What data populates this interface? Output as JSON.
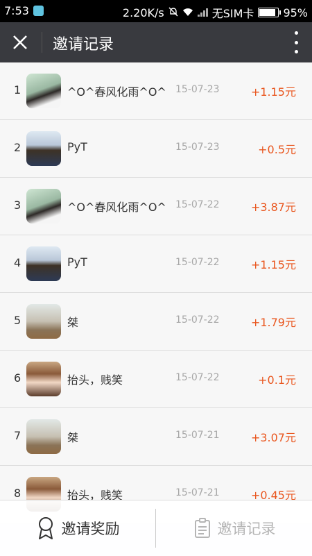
{
  "status": {
    "time": "7:53",
    "speed": "2.20K/s",
    "carrier": "无SIM卡",
    "battery": "95%",
    "icons": [
      "app-icon",
      "alarm-off-icon",
      "wifi-icon",
      "signal-icon",
      "battery-icon"
    ]
  },
  "header": {
    "title": "邀请记录",
    "close_icon": "close-icon",
    "more_icon": "more-vertical-icon"
  },
  "records": [
    {
      "rank": "1",
      "name": "^O^春风化雨^O^",
      "date": "15-07-23",
      "amount": "+1.15元"
    },
    {
      "rank": "2",
      "name": "PyT",
      "date": "15-07-23",
      "amount": "+0.5元"
    },
    {
      "rank": "3",
      "name": "^O^春风化雨^O^",
      "date": "15-07-22",
      "amount": "+3.87元"
    },
    {
      "rank": "4",
      "name": "PyT",
      "date": "15-07-22",
      "amount": "+1.15元"
    },
    {
      "rank": "5",
      "name": "桀",
      "date": "15-07-22",
      "amount": "+1.79元"
    },
    {
      "rank": "6",
      "name": "抬头，贱笑",
      "date": "15-07-22",
      "amount": "+0.1元"
    },
    {
      "rank": "7",
      "name": "桀",
      "date": "15-07-21",
      "amount": "+3.07元"
    },
    {
      "rank": "8",
      "name": "抬头，贱笑",
      "date": "15-07-21",
      "amount": "+0.45元"
    }
  ],
  "tabs": {
    "reward_label": "邀请奖励",
    "records_label": "邀请记录"
  },
  "colors": {
    "titlebar": "#393a3f",
    "amount": "#e9561e",
    "inactive_tab": "#b5b5b5"
  }
}
